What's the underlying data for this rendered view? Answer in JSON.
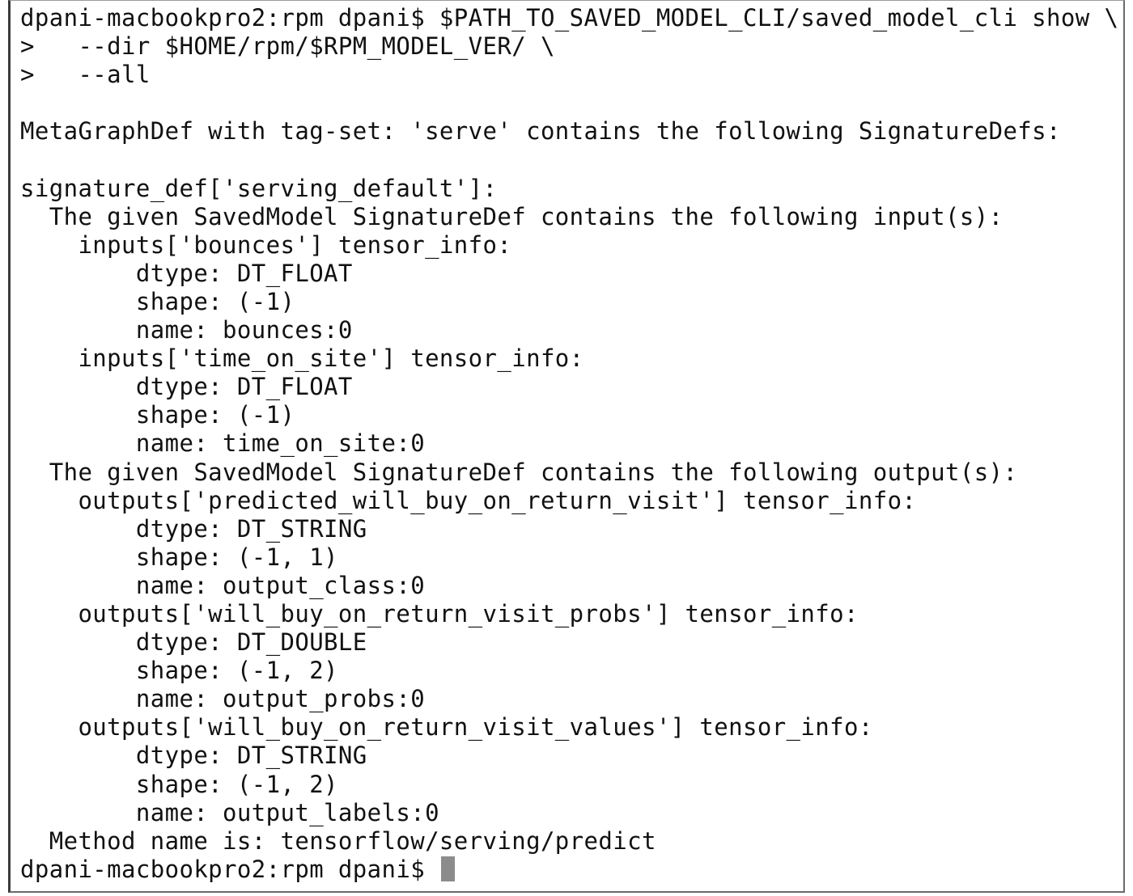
{
  "terminal": {
    "lines": [
      "dpani-macbookpro2:rpm dpani$ $PATH_TO_SAVED_MODEL_CLI/saved_model_cli show \\",
      ">   --dir $HOME/rpm/$RPM_MODEL_VER/ \\",
      ">   --all",
      "",
      "MetaGraphDef with tag-set: 'serve' contains the following SignatureDefs:",
      "",
      "signature_def['serving_default']:",
      "  The given SavedModel SignatureDef contains the following input(s):",
      "    inputs['bounces'] tensor_info:",
      "        dtype: DT_FLOAT",
      "        shape: (-1)",
      "        name: bounces:0",
      "    inputs['time_on_site'] tensor_info:",
      "        dtype: DT_FLOAT",
      "        shape: (-1)",
      "        name: time_on_site:0",
      "  The given SavedModel SignatureDef contains the following output(s):",
      "    outputs['predicted_will_buy_on_return_visit'] tensor_info:",
      "        dtype: DT_STRING",
      "        shape: (-1, 1)",
      "        name: output_class:0",
      "    outputs['will_buy_on_return_visit_probs'] tensor_info:",
      "        dtype: DT_DOUBLE",
      "        shape: (-1, 2)",
      "        name: output_probs:0",
      "    outputs['will_buy_on_return_visit_values'] tensor_info:",
      "        dtype: DT_STRING",
      "        shape: (-1, 2)",
      "        name: output_labels:0",
      "  Method name is: tensorflow/serving/predict"
    ],
    "prompt": "dpani-macbookpro2:rpm dpani$ "
  }
}
